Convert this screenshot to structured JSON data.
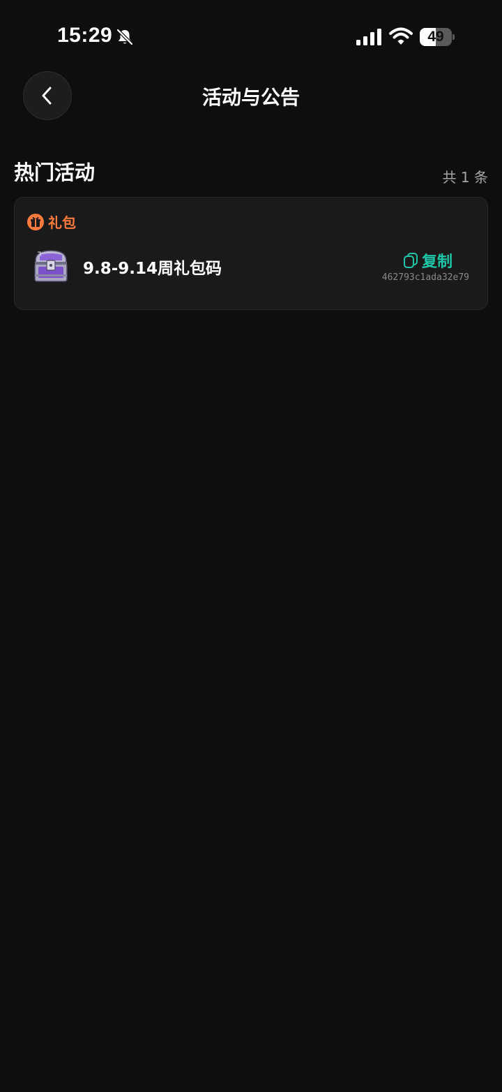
{
  "status_bar": {
    "time": "15:29",
    "battery_level": "49",
    "battery_fraction": 0.49,
    "icons": [
      "bell-muted-icon",
      "signal-icon",
      "wifi-icon",
      "battery-icon"
    ]
  },
  "header": {
    "title": "活动与公告",
    "back_icon": "chevron-left-icon"
  },
  "section": {
    "title": "热门活动",
    "count": "共 1 条"
  },
  "items": [
    {
      "tag_label": "礼包",
      "tag_icon": "gift-icon",
      "image": "treasure-chest-image",
      "title": "9.8-9.14周礼包码",
      "copy_label": "复制",
      "copy_icon": "copy-icon",
      "code": "462793c1ada32e79"
    }
  ],
  "colors": {
    "background": "#0e0e0e",
    "card": "#1a1a1a",
    "tag": "#ff7a3d",
    "accent": "#1ec6a8",
    "muted_text": "#a6a6a6"
  }
}
